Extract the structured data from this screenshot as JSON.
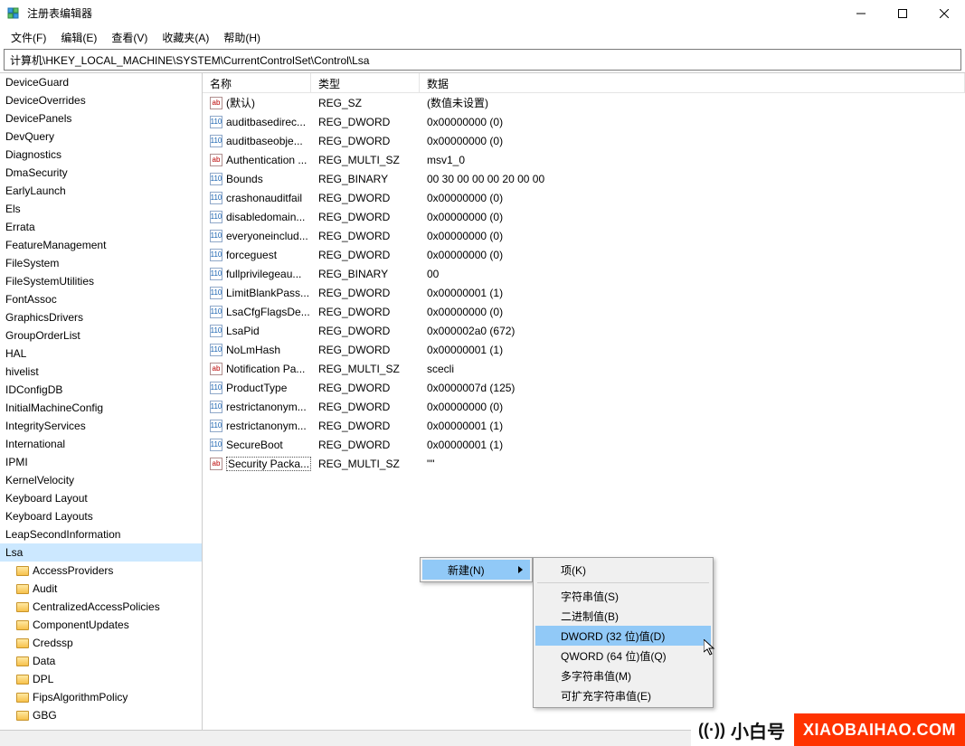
{
  "window": {
    "title": "注册表编辑器"
  },
  "menus": {
    "file": "文件(F)",
    "edit": "编辑(E)",
    "view": "查看(V)",
    "fav": "收藏夹(A)",
    "help": "帮助(H)"
  },
  "address": {
    "path": "计算机\\HKEY_LOCAL_MACHINE\\SYSTEM\\CurrentControlSet\\Control\\Lsa"
  },
  "columns": {
    "name": "名称",
    "type": "类型",
    "data": "数据"
  },
  "tree": {
    "items": [
      "DeviceGuard",
      "DeviceOverrides",
      "DevicePanels",
      "DevQuery",
      "Diagnostics",
      "DmaSecurity",
      "EarlyLaunch",
      "Els",
      "Errata",
      "FeatureManagement",
      "FileSystem",
      "FileSystemUtilities",
      "FontAssoc",
      "GraphicsDrivers",
      "GroupOrderList",
      "HAL",
      "hivelist",
      "IDConfigDB",
      "InitialMachineConfig",
      "IntegrityServices",
      "International",
      "IPMI",
      "KernelVelocity",
      "Keyboard Layout",
      "Keyboard Layouts",
      "LeapSecondInformation",
      "Lsa"
    ],
    "selected": "Lsa",
    "children": [
      "AccessProviders",
      "Audit",
      "CentralizedAccessPolicies",
      "ComponentUpdates",
      "Credssp",
      "Data",
      "DPL",
      "FipsAlgorithmPolicy",
      "GBG"
    ]
  },
  "values": [
    {
      "name": "(默认)",
      "type": "REG_SZ",
      "data": "(数值未设置)",
      "icon": "sz"
    },
    {
      "name": "auditbasedirec...",
      "type": "REG_DWORD",
      "data": "0x00000000 (0)",
      "icon": "bin"
    },
    {
      "name": "auditbaseobje...",
      "type": "REG_DWORD",
      "data": "0x00000000 (0)",
      "icon": "bin"
    },
    {
      "name": "Authentication ...",
      "type": "REG_MULTI_SZ",
      "data": "msv1_0",
      "icon": "sz"
    },
    {
      "name": "Bounds",
      "type": "REG_BINARY",
      "data": "00 30 00 00 00 20 00 00",
      "icon": "bin"
    },
    {
      "name": "crashonauditfail",
      "type": "REG_DWORD",
      "data": "0x00000000 (0)",
      "icon": "bin"
    },
    {
      "name": "disabledomain...",
      "type": "REG_DWORD",
      "data": "0x00000000 (0)",
      "icon": "bin"
    },
    {
      "name": "everyoneinclud...",
      "type": "REG_DWORD",
      "data": "0x00000000 (0)",
      "icon": "bin"
    },
    {
      "name": "forceguest",
      "type": "REG_DWORD",
      "data": "0x00000000 (0)",
      "icon": "bin"
    },
    {
      "name": "fullprivilegeau...",
      "type": "REG_BINARY",
      "data": "00",
      "icon": "bin"
    },
    {
      "name": "LimitBlankPass...",
      "type": "REG_DWORD",
      "data": "0x00000001 (1)",
      "icon": "bin"
    },
    {
      "name": "LsaCfgFlagsDe...",
      "type": "REG_DWORD",
      "data": "0x00000000 (0)",
      "icon": "bin"
    },
    {
      "name": "LsaPid",
      "type": "REG_DWORD",
      "data": "0x000002a0 (672)",
      "icon": "bin"
    },
    {
      "name": "NoLmHash",
      "type": "REG_DWORD",
      "data": "0x00000001 (1)",
      "icon": "bin"
    },
    {
      "name": "Notification Pa...",
      "type": "REG_MULTI_SZ",
      "data": "scecli",
      "icon": "sz"
    },
    {
      "name": "ProductType",
      "type": "REG_DWORD",
      "data": "0x0000007d (125)",
      "icon": "bin"
    },
    {
      "name": "restrictanonym...",
      "type": "REG_DWORD",
      "data": "0x00000000 (0)",
      "icon": "bin"
    },
    {
      "name": "restrictanonym...",
      "type": "REG_DWORD",
      "data": "0x00000001 (1)",
      "icon": "bin"
    },
    {
      "name": "SecureBoot",
      "type": "REG_DWORD",
      "data": "0x00000001 (1)",
      "icon": "bin"
    },
    {
      "name": "Security Packa...",
      "type": "REG_MULTI_SZ",
      "data": "\"\"",
      "icon": "sz",
      "selected": true
    }
  ],
  "context": {
    "primary": {
      "label": "新建(N)"
    },
    "submenu": {
      "key": "项(K)",
      "string": "字符串值(S)",
      "binary": "二进制值(B)",
      "dword": "DWORD (32 位)值(D)",
      "qword": "QWORD (64 位)值(Q)",
      "multi": "多字符串值(M)",
      "expandable": "可扩充字符串值(E)"
    }
  },
  "watermark": {
    "left": "小白号",
    "right": "XIAOBAIHAO.COM"
  }
}
